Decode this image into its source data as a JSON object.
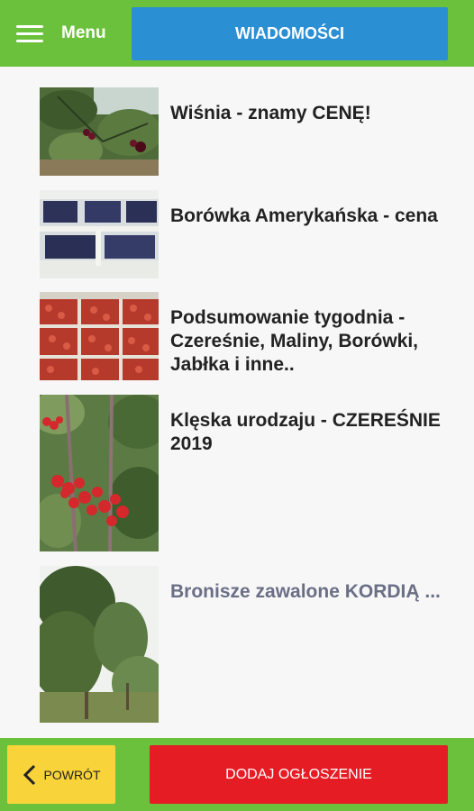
{
  "header": {
    "menu_label": "Menu",
    "news_label": "WIADOMOŚCI"
  },
  "articles": [
    {
      "title": "Wiśnia - znamy CENĘ!",
      "image": "cherries-on-tree-photo"
    },
    {
      "title": "Borówka Amerykańska - cena",
      "image": "blueberry-crates-photo"
    },
    {
      "title": "Podsumowanie tygodnia - Czereśnie, Maliny, Borówki, Jabłka i inne..",
      "image": "cherry-crates-photo"
    },
    {
      "title": "Klęska urodzaju - CZEREŚNIE 2019",
      "image": "cherry-branch-photo"
    },
    {
      "title": "Bronisze zawalone KORDIĄ ...",
      "image": "orchard-trees-photo"
    }
  ],
  "footer": {
    "back_label": "POWRÓT",
    "add_label": "DODAJ OGŁOSZENIE"
  },
  "colors": {
    "bar_green": "#6bc13c",
    "news_blue": "#2b8fd4",
    "back_yellow": "#f9d33a",
    "add_red": "#e61c24"
  }
}
